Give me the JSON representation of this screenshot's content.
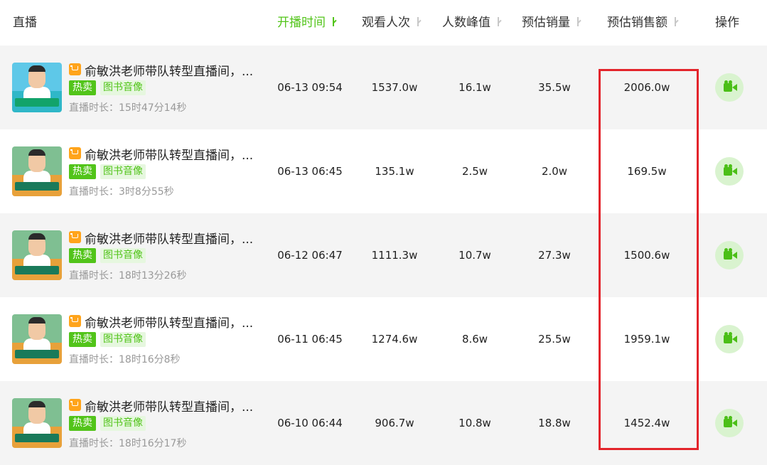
{
  "header": {
    "col_live": "直播",
    "col_start_time": "开播时间",
    "col_views": "观看人次",
    "col_peak": "人数峰值",
    "col_est_sales": "预估销量",
    "col_est_gmv": "预估销售额",
    "col_actions": "操作"
  },
  "rows": [
    {
      "title": "俞敏洪老师带队转型直播间，...",
      "tag_hot": "热卖",
      "tag_category": "图书音像",
      "duration": "直播时长：15时47分14秒",
      "start_time": "06-13 09:54",
      "views": "1537.0w",
      "peak": "16.1w",
      "est_sales": "35.5w",
      "est_gmv": "2006.0w"
    },
    {
      "title": "俞敏洪老师带队转型直播间，...",
      "tag_hot": "热卖",
      "tag_category": "图书音像",
      "duration": "直播时长：3时8分55秒",
      "start_time": "06-13 06:45",
      "views": "135.1w",
      "peak": "2.5w",
      "est_sales": "2.0w",
      "est_gmv": "169.5w"
    },
    {
      "title": "俞敏洪老师带队转型直播间，...",
      "tag_hot": "热卖",
      "tag_category": "图书音像",
      "duration": "直播时长：18时13分26秒",
      "start_time": "06-12 06:47",
      "views": "1111.3w",
      "peak": "10.7w",
      "est_sales": "27.3w",
      "est_gmv": "1500.6w"
    },
    {
      "title": "俞敏洪老师带队转型直播间，...",
      "tag_hot": "热卖",
      "tag_category": "图书音像",
      "duration": "直播时长：18时16分8秒",
      "start_time": "06-11 06:45",
      "views": "1274.6w",
      "peak": "8.6w",
      "est_sales": "25.5w",
      "est_gmv": "1959.1w"
    },
    {
      "title": "俞敏洪老师带队转型直播间，...",
      "tag_hot": "热卖",
      "tag_category": "图书音像",
      "duration": "直播时长：18时16分17秒",
      "start_time": "06-10 06:44",
      "views": "906.7w",
      "peak": "10.8w",
      "est_sales": "18.8w",
      "est_gmv": "1452.4w"
    }
  ],
  "icons": {
    "cart": "shopping-cart-icon",
    "action": "video-camera-icon",
    "sort": "sort-arrow-down-icon"
  },
  "colors": {
    "accent": "#52c41a",
    "cart": "#ffa41b",
    "highlight": "#e3242b",
    "row_shade": "#f4f4f4"
  }
}
